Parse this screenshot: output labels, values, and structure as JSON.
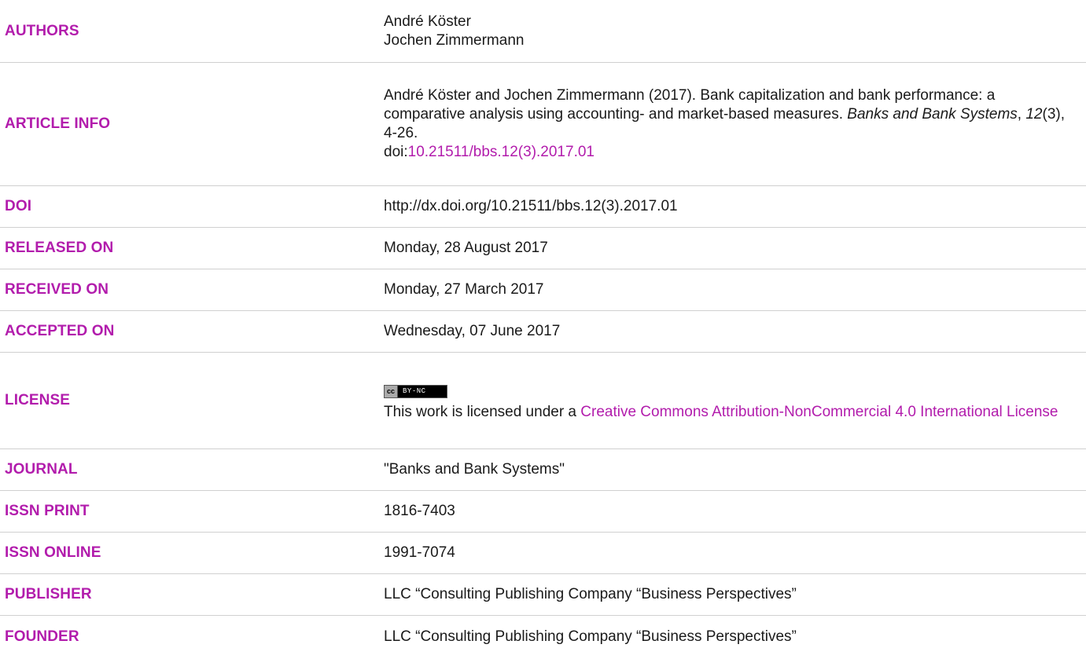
{
  "authors": {
    "label": "AUTHORS",
    "names": [
      "André Köster",
      "Jochen Zimmermann"
    ]
  },
  "article_info": {
    "label": "ARTICLE INFO",
    "citation_text": "André Köster and Jochen Zimmermann (2017). Bank capitalization and bank performance: a comparative analysis using accounting- and market-based measures. ",
    "journal_italic": "Banks and Bank Systems",
    "sep1": ", ",
    "volume_italic": "12",
    "issue_pages": "(3), 4-26.",
    "doi_prefix": "doi:",
    "doi_link": "10.21511/bbs.12(3).2017.01"
  },
  "doi": {
    "label": "DOI",
    "value": "http://dx.doi.org/10.21511/bbs.12(3).2017.01"
  },
  "released_on": {
    "label": "RELEASED ON",
    "value": "Monday, 28 August 2017"
  },
  "received_on": {
    "label": "RECEIVED ON",
    "value": "Monday, 27 March 2017"
  },
  "accepted_on": {
    "label": "ACCEPTED ON",
    "value": "Wednesday, 07 June 2017"
  },
  "license": {
    "label": "LICENSE",
    "badge_cc": "cc",
    "badge_text": "BY-NC",
    "prefix": "This work is licensed under a ",
    "link_text": "Creative Commons Attribution-NonCommercial 4.0 International License"
  },
  "journal": {
    "label": "JOURNAL",
    "value": "\"Banks and Bank Systems\""
  },
  "issn_print": {
    "label": "ISSN PRINT",
    "value": "1816-7403"
  },
  "issn_online": {
    "label": "ISSN ONLINE",
    "value": "1991-7074"
  },
  "publisher": {
    "label": "PUBLISHER",
    "value": "LLC “Consulting Publishing Company “Business Perspectives”"
  },
  "founder": {
    "label": "FOUNDER",
    "value": "LLC “Consulting Publishing Company “Business Perspectives”"
  },
  "colors": {
    "label": "#b21cac",
    "link": "#b21cac",
    "text": "#1a1a1a",
    "divider": "#d0d0d0"
  }
}
